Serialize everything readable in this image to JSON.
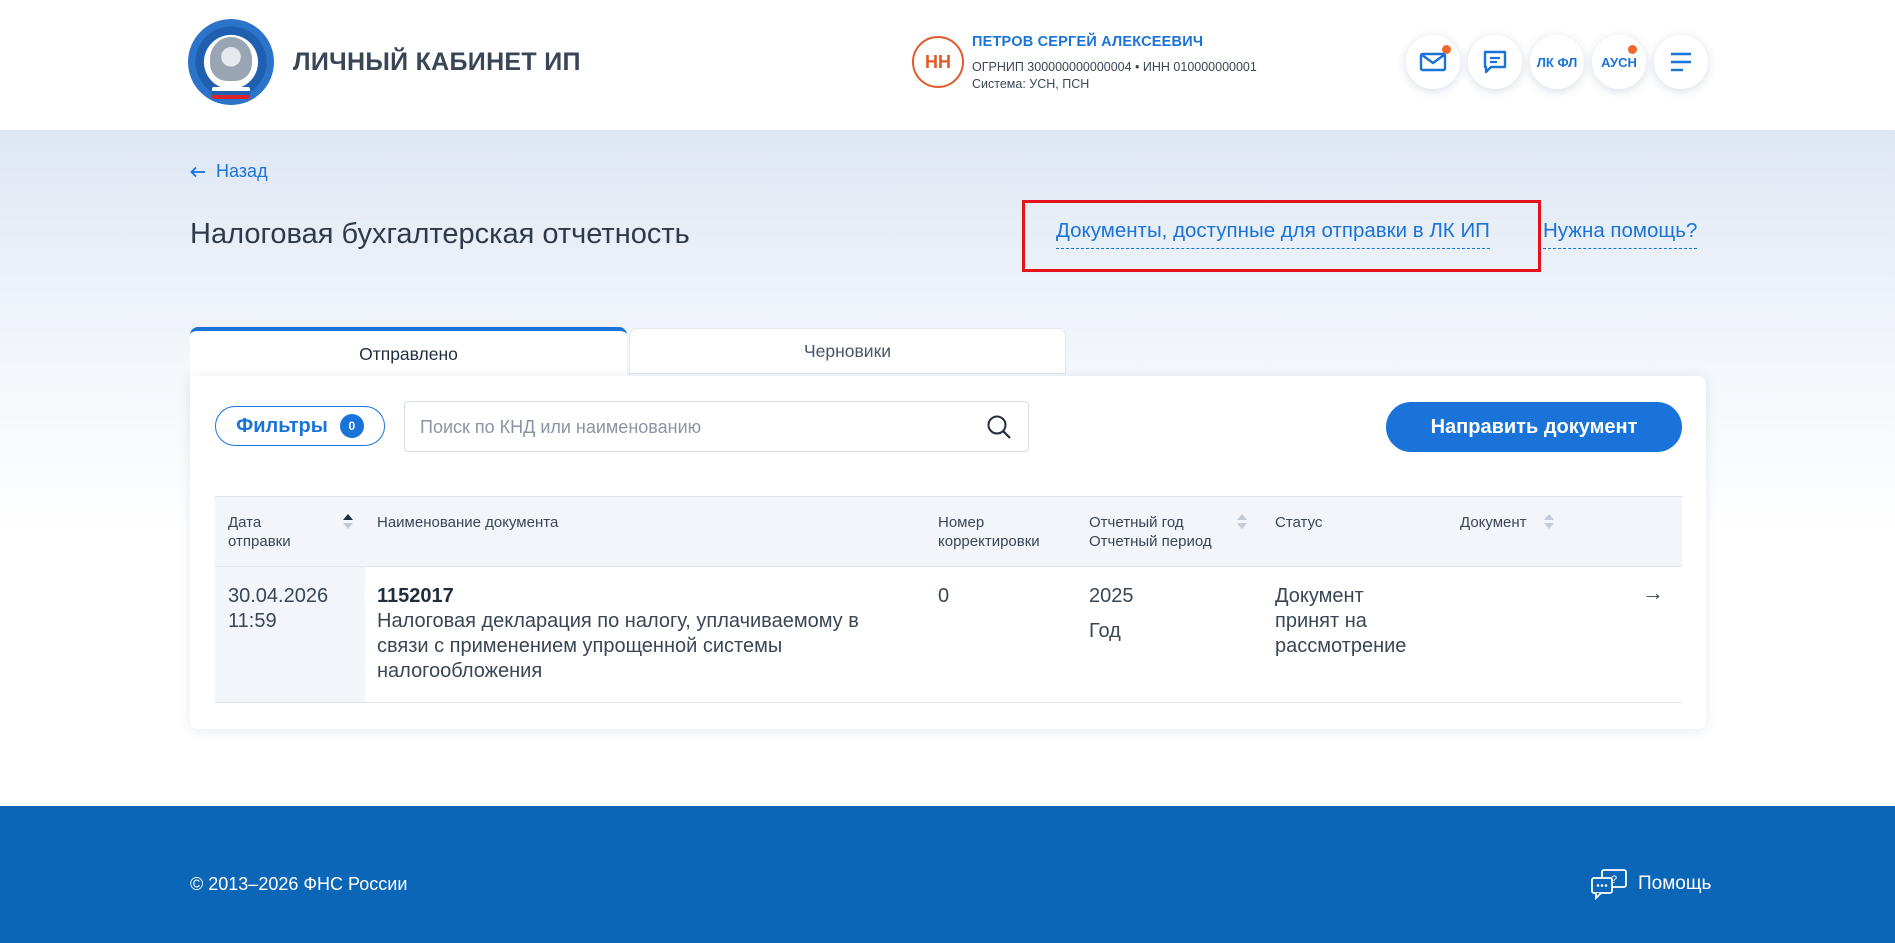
{
  "header": {
    "app_title": "ЛИЧНЫЙ КАБИНЕТ ИП",
    "user": {
      "initials": "НН",
      "name": "ПЕТРОВ СЕРГЕЙ АЛЕКСЕЕВИЧ",
      "ids": "ОГРНИП 300000000000004 • ИНН 010000000001",
      "system": "Система: УСН, ПСН"
    },
    "buttons": {
      "lk_fl": "ЛК ФЛ",
      "ausn": "АУСН"
    }
  },
  "nav": {
    "back_label": "Назад"
  },
  "page": {
    "title": "Налоговая бухгалтерская отчетность",
    "docs_link": "Документы, доступные для отправки в ЛК ИП",
    "help_link": "Нужна помощь?"
  },
  "tabs": [
    {
      "label": "Отправлено",
      "active": true
    },
    {
      "label": "Черновики",
      "active": false
    }
  ],
  "toolbar": {
    "filters_label": "Фильтры",
    "filters_count": "0",
    "search_placeholder": "Поиск по КНД или наименованию",
    "send_button": "Направить документ"
  },
  "table": {
    "columns": {
      "date_line1": "Дата",
      "date_line2": "отправки",
      "name": "Наименование документа",
      "correction_line1": "Номер",
      "correction_line2": "корректировки",
      "year_line1": "Отчетный год",
      "year_line2": "Отчетный период",
      "status": "Статус",
      "document": "Документ"
    },
    "rows": [
      {
        "date": "30.04.2026",
        "time": "11:59",
        "knd": "1152017",
        "name_line1": "Налоговая декларация по налогу, уплачиваемому в",
        "name_line2": "связи с применением упрощенной системы",
        "name_line3": "налогообложения",
        "correction": "0",
        "year": "2025",
        "period": "Год",
        "status_line1": "Документ",
        "status_line2": "принят на",
        "status_line3": "рассмотрение"
      }
    ]
  },
  "footer": {
    "copyright": "© 2013–2026 ФНС России",
    "help": "Помощь"
  },
  "colors": {
    "accent": "#1a73d9",
    "footer": "#0b66b8",
    "avatar": "#e35a2a",
    "highlight": "#e3121b"
  }
}
